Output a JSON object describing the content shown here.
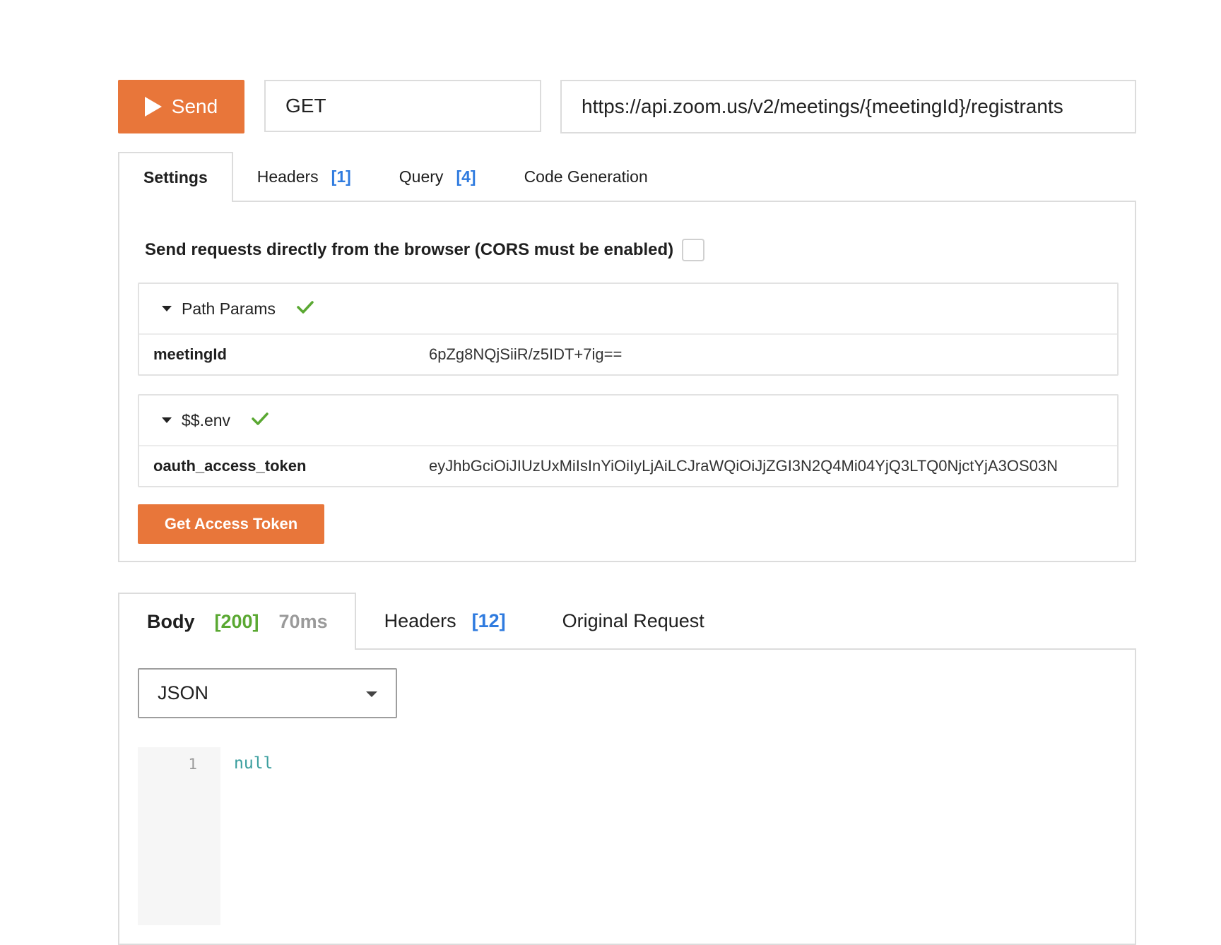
{
  "request": {
    "send_label": "Send",
    "method": "GET",
    "url": "https://api.zoom.us/v2/meetings/{meetingId}/registrants"
  },
  "settings_tabs": [
    {
      "label": "Settings",
      "count": ""
    },
    {
      "label": "Headers",
      "count": "[1]"
    },
    {
      "label": "Query",
      "count": "[4]"
    },
    {
      "label": "Code Generation",
      "count": ""
    }
  ],
  "settings": {
    "cors_label": "Send requests directly from the browser (CORS must be enabled)",
    "cors_checked": false,
    "path_params": {
      "title": "Path Params",
      "rows": [
        {
          "key": "meetingId",
          "value": "6pZg8NQjSiiR/z5IDT+7ig=="
        }
      ]
    },
    "env": {
      "title": "$$.env",
      "rows": [
        {
          "key": "oauth_access_token",
          "value": "eyJhbGciOiJIUzUxMiIsInYiOiIyLjAiLCJraWQiOiJjZGI3N2Q4Mi04YjQ3LTQ0NjctYjA3OS03N"
        }
      ]
    },
    "token_button": "Get Access Token"
  },
  "response_tabs": {
    "body": {
      "label": "Body",
      "status": "[200]",
      "time": "70ms"
    },
    "headers": {
      "label": "Headers",
      "count": "[12]"
    },
    "original": {
      "label": "Original Request"
    }
  },
  "response": {
    "format": "JSON",
    "line_number": "1",
    "code": "null"
  },
  "colors": {
    "accent": "#e8763a",
    "link": "#2f7bdf",
    "success": "#5aa832",
    "code": "#3a9e9e"
  }
}
